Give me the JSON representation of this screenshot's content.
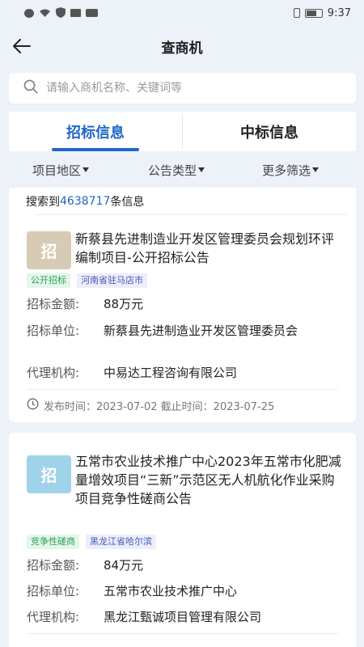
{
  "status_bar": {
    "time": "9:37",
    "left_icons": [
      "alert-icon",
      "shield-icon",
      "mail-icon",
      "hd-icon",
      "wifi-icon"
    ],
    "right_icons": [
      "vibrate-icon",
      "battery-icon"
    ]
  },
  "header": {
    "title": "查商机"
  },
  "search": {
    "placeholder": "请输入商机名称、关键词等"
  },
  "tabs": [
    {
      "label": "招标信息",
      "active": true
    },
    {
      "label": "中标信息",
      "active": false
    }
  ],
  "filters": [
    {
      "label": "项目地区"
    },
    {
      "label": "公告类型"
    },
    {
      "label": "更多筛选"
    }
  ],
  "result": {
    "prefix": "搜索到",
    "count": "4638717",
    "suffix": "条信息"
  },
  "cards": [
    {
      "badge": "招",
      "title": "新蔡县先进制造业开发区管理委员会规划环评编制项目-公开招标公告",
      "tags": [
        "公开招标",
        "河南省驻马店市"
      ],
      "amount_label": "招标金额:",
      "amount": "88万元",
      "unit_label": "招标单位:",
      "unit": "新蔡县先进制造业开发区管理委员会",
      "agency_label": "代理机构:",
      "agency": "中易达工程咨询有限公司",
      "dates": "发布时间：2023-07-02  截止时间：2023-07-25"
    },
    {
      "badge": "招",
      "title": "五常市农业技术推广中心2023年五常市化肥减量增效项目“三新”示范区无人机航化作业采购项目竞争性磋商公告",
      "tags": [
        "竞争性磋商",
        "黑龙江省哈尔滨"
      ],
      "amount_label": "招标金额:",
      "amount": "84万元",
      "unit_label": "招标单位:",
      "unit": "五常市农业技术推广中心",
      "agency_label": "代理机构:",
      "agency": "黑龙江甄诚项目管理有限公司"
    }
  ],
  "colors": {
    "accent": "#2166c9",
    "background": "#edf1f8",
    "tag_green": "#2aa257",
    "tag_blue": "#4657b8"
  }
}
